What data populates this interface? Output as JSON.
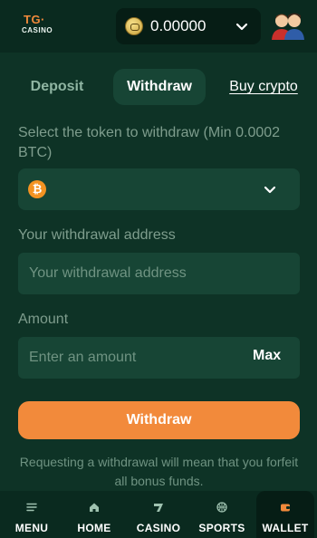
{
  "header": {
    "logo_top": "TG·",
    "logo_bottom": "CASINO",
    "balance": "0.00000",
    "coin_icon": "coin-icon",
    "avatar": "user-avatar"
  },
  "tabs": [
    {
      "label": "Deposit",
      "active": false
    },
    {
      "label": "Withdraw",
      "active": true
    },
    {
      "label": "Buy crypto",
      "active": false
    }
  ],
  "form": {
    "token_label": "Select the token to withdraw (Min 0.0002 BTC)",
    "token_icon": "bitcoin-icon",
    "token_symbol": "₿",
    "address_label": "Your withdrawal address",
    "address_placeholder": "Your withdrawal address",
    "amount_label": "Amount",
    "amount_placeholder": "Enter an amount",
    "max_label": "Max",
    "submit_label": "Withdraw",
    "notice": "Requesting a withdrawal will mean that you forfeit all bonus funds."
  },
  "nav": [
    {
      "label": "MENU",
      "icon": "menu-icon"
    },
    {
      "label": "HOME",
      "icon": "home-icon"
    },
    {
      "label": "CASINO",
      "icon": "casino-icon"
    },
    {
      "label": "SPORTS",
      "icon": "sports-ball-icon"
    },
    {
      "label": "WALLET",
      "icon": "wallet-icon",
      "active": true
    }
  ],
  "colors": {
    "background": "#0e3326",
    "panel": "#174535",
    "accent": "#f28a3b",
    "bitcoin": "#f39322"
  }
}
